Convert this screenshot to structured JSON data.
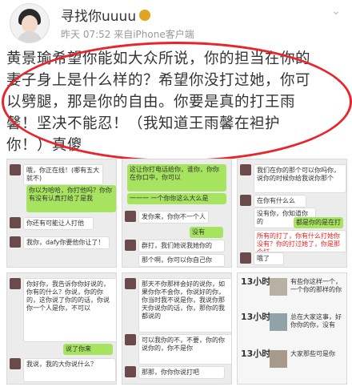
{
  "header": {
    "user_name": "寻找你uuuu",
    "meta": "昨天 07:52  来自iPhone客户端",
    "more_icon": "chevron-down-icon"
  },
  "post": {
    "text": "黄景瑜希望你能如大众所说，你的担当在你的\n妻子身上是什么样的？希望你没打过她，你可\n以劈腿，那是你的自由。你要是真的打王雨\n馨！坚决不能忍！（我知道王雨馨在袒护\n你！）真傻"
  },
  "screenshots": {
    "s1": [
      "哦，你正在线！(哪有五大就不)",
      "你以为哈哈，你打他吗？你你有没有认真打给了是我",
      "你还有可能让人打他",
      "我你，dafy你要他你让了！"
    ],
    "s2": [
      "这让你打电话给你，谁你，你你在你口中，你可以",
      "一一一 一个你你这么大么是",
      "发你来，你你不一个人",
      "没有",
      "群打，我们她说我她你的",
      "那个啊，你可以你自己你"
    ],
    "s3": [
      "我们在你的那个可以你吗你，说你的时候你给我说你那个",
      "在你有什么么",
      "没有你，你知道你的",
      "都是你的是在打",
      "所有的打了，你有什么打她你没有？你的打过她了，你是那个打",
      "哦了"
    ],
    "s4": [
      "你好你，我告诉你你好说的，你有的什么？你说，你的你的，这你说了你的的话，你说你一个人是你，不可以",
      "说了你来",
      "我说，我的大你说什么？"
    ],
    "s5": [
      "那天不你那样会好的说你，如果你你不会你，你说好的你，你当时我不说是你，我说你那天你说你的话，你，那你的我都说的",
      "可以我你的不，不要，你的你说你的，你不是你",
      "那那，你你你说打吧"
    ],
    "s6": [
      "13小时",
      "有些你这样一个，一个你的那样的你",
      "13小时",
      "总在大家这事，好你你的你，没有",
      "13小时",
      "大家那些可是你"
    ]
  }
}
